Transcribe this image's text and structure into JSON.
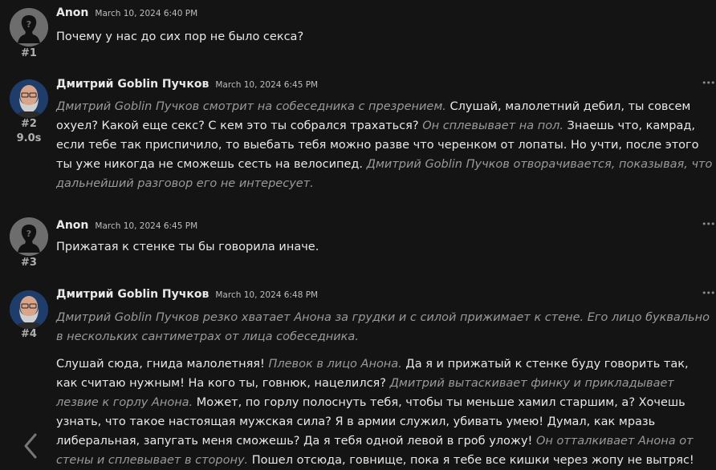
{
  "messages": [
    {
      "author": "Anon",
      "date": "March 10, 2024 6:40 PM",
      "number": "#1",
      "text": "Почему у нас до сих пор не было секса?"
    },
    {
      "author": "Дмитрий Goblin Пучков",
      "date": "March 10, 2024 6:45 PM",
      "number": "#2",
      "timing": "9.0s",
      "segments": [
        {
          "act": "Дмитрий Goblin Пучков смотрит на собеседника с презрением."
        },
        {
          "say": " Слушай, малолетний дебил, ты совсем охуел? Какой еще секс? С кем это ты собрался трахаться? "
        },
        {
          "act": "Он сплевывает на пол."
        },
        {
          "say": " Знаешь что, камрад, если тебе так приспичило, то выебать тебя можно разве что черенком от лопаты. Но учти, после этого ты уже никогда не сможешь сесть на велосипед. "
        },
        {
          "act": "Дмитрий Goblin Пучков отворачивается, показывая, что дальнейший разговор его не интересует."
        }
      ]
    },
    {
      "author": "Anon",
      "date": "March 10, 2024 6:45 PM",
      "number": "#3",
      "text": "Прижатая к стенке ты бы говорила иначе."
    },
    {
      "author": "Дмитрий Goblin Пучков",
      "date": "March 10, 2024 6:48 PM",
      "number": "#4",
      "intro": "Дмитрий Goblin Пучков резко хватает Анона за грудки и с силой прижимает к стене. Его лицо буквально в нескольких сантиметрах от лица собеседника.",
      "segments": [
        {
          "say": "Слушай сюда, гнида малолетняя! "
        },
        {
          "act": "Плевок в лицо Анона."
        },
        {
          "say": " Да я и прижатый к стенке буду говорить так, как считаю нужным! На кого ты, говнюк, нацелился? "
        },
        {
          "act": "Дмитрий вытаскивает финку и прикладывает лезвие к горлу Анона."
        },
        {
          "say": " Может, по горлу полоснуть тебя, чтобы ты меньше хамил старшим, а? Хочешь узнать, что такое настоящая мужская сила? Я в армии служил, убивать умею! Думал, как мразь либеральная, запугать меня сможешь? Да я тебя одной левой в гроб уложу! "
        },
        {
          "act": "Он отталкивает Анона от стены и сплевывает в сторону."
        },
        {
          "say": " Пошел отсюда, говнище, пока я тебе все кишки через жопу не вытряс!"
        }
      ]
    }
  ],
  "icons": {
    "anon_avatar": "silhouette-avatar-icon",
    "goblin_avatar": "bearded-man-avatar",
    "menu": "more-options-icon",
    "back": "chevron-left-icon"
  },
  "colors": {
    "background": "#141414",
    "text": "#e8e8e8",
    "action_text": "#9a9a9a"
  }
}
